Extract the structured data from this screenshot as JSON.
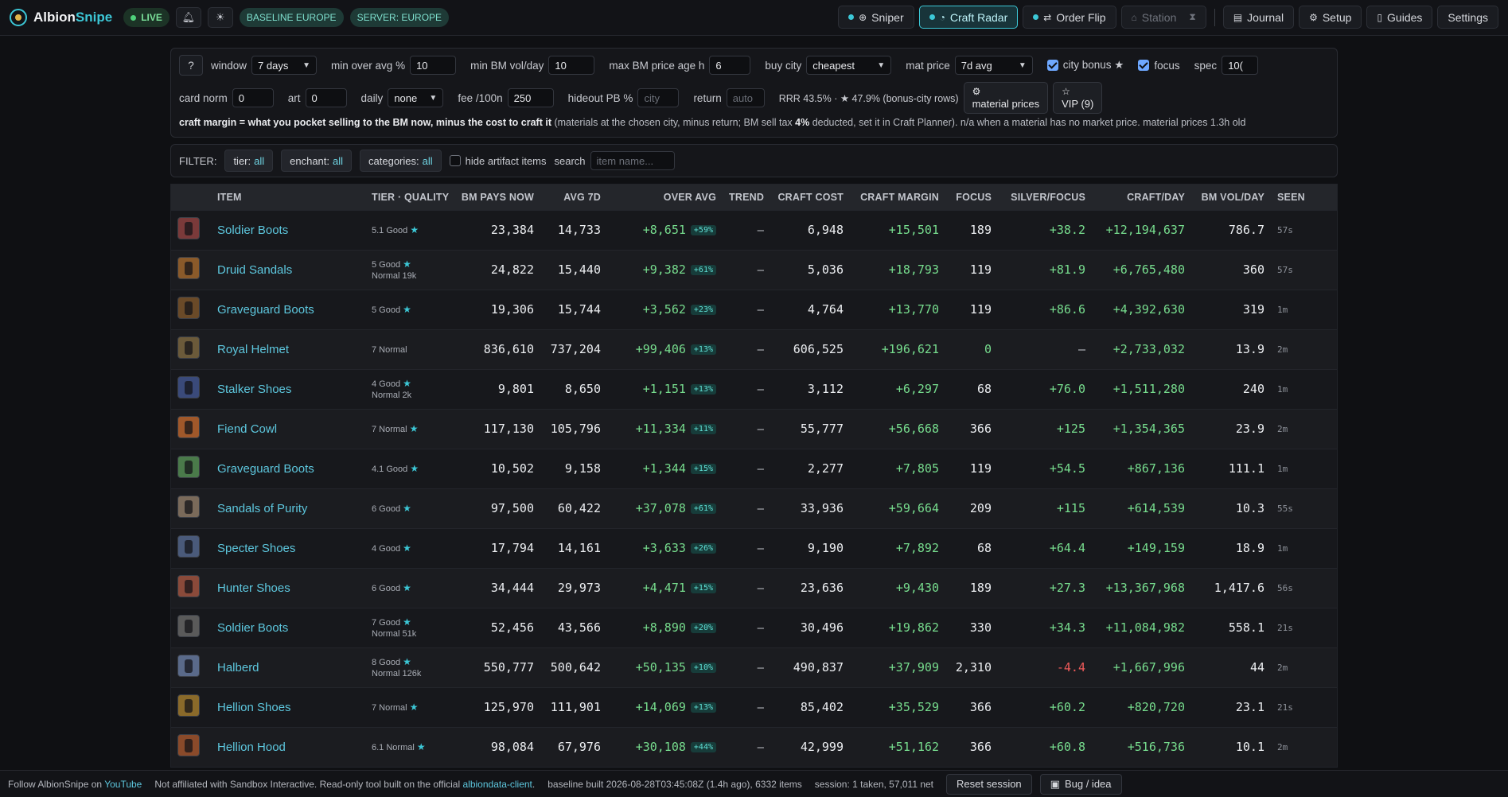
{
  "header": {
    "brand_a": "Albion",
    "brand_b": "Snipe",
    "live": "LIVE",
    "baseline": "BASELINE EUROPE",
    "server": "SERVER: EUROPE",
    "nav": [
      {
        "label": "Sniper",
        "icon": "target-icon"
      },
      {
        "label": "Craft Radar",
        "icon": "radar-icon"
      },
      {
        "label": "Order Flip",
        "icon": "swap-icon"
      },
      {
        "label": "Station",
        "icon": "house-icon"
      },
      {
        "label": "Journal",
        "icon": "journal-icon"
      },
      {
        "label": "Setup",
        "icon": "gear-icon"
      },
      {
        "label": "Guides",
        "icon": "book-icon"
      },
      {
        "label": "Settings"
      }
    ]
  },
  "controls": {
    "help": "?",
    "window_label": "window",
    "window_value": "7 days",
    "min_over_avg_label": "min over avg %",
    "min_over_avg_value": "10",
    "min_bm_vol_label": "min BM vol/day",
    "min_bm_vol_value": "10",
    "max_bm_age_label": "max BM price age h",
    "max_bm_age_value": "6",
    "buy_city_label": "buy city",
    "buy_city_value": "cheapest",
    "mat_price_label": "mat price",
    "mat_price_value": "7d avg",
    "city_bonus_label": "city bonus ★",
    "focus_label": "focus",
    "spec_label": "spec",
    "spec_value": "10(",
    "card_norm_label": "card norm",
    "card_norm_value": "0",
    "art_label": "art",
    "art_value": "0",
    "daily_label": "daily",
    "daily_value": "none",
    "fee_label": "fee /100n",
    "fee_value": "250",
    "hideout_label": "hideout PB %",
    "hideout_placeholder": "city",
    "return_label": "return",
    "return_placeholder": "auto",
    "rrr_text": "RRR 43.5% · ★ 47.9% (bonus-city rows)",
    "material_prices_label": "material prices",
    "vip_label": "VIP (9)",
    "desc_bold": "craft margin = what you pocket selling to the BM now, minus the cost to craft it",
    "desc_rest_a": " (materials at the chosen city, minus return; BM sell tax ",
    "desc_tax": "4%",
    "desc_rest_b": " deducted, set it in Craft Planner). n/a when a material has no market price. material prices 1.3h old"
  },
  "filters": {
    "label": "FILTER:",
    "tier_label": "tier:",
    "tier_value": "all",
    "enchant_label": "enchant:",
    "enchant_value": "all",
    "categories_label": "categories:",
    "categories_value": "all",
    "hide_artifact": "hide artifact items",
    "search_label": "search",
    "search_placeholder": "item name..."
  },
  "table": {
    "columns": [
      "ITEM",
      "TIER · QUALITY",
      "BM PAYS NOW",
      "AVG 7D",
      "OVER AVG",
      "TREND",
      "CRAFT COST",
      "CRAFT MARGIN",
      "FOCUS",
      "SILVER/FOCUS",
      "CRAFT/DAY",
      "BM VOL/DAY",
      "SEEN"
    ],
    "rows": [
      {
        "icon": "#7a3a3a",
        "name": "Soldier Boots",
        "tier": "5.1 Good",
        "star": "★",
        "sub": "",
        "bm": "23,384",
        "avg": "14,733",
        "over": "+8,651",
        "pct": "+59%",
        "trend": "–",
        "cost": "6,948",
        "margin": "+15,501",
        "focus": "189",
        "spf": "+38.2",
        "cpd": "+12,194,637",
        "vol": "786.7",
        "seen": "57s"
      },
      {
        "icon": "#8a5a2a",
        "name": "Druid Sandals",
        "tier": "5 Good",
        "star": "★",
        "sub": "Normal 19k",
        "bm": "24,822",
        "avg": "15,440",
        "over": "+9,382",
        "pct": "+61%",
        "trend": "–",
        "cost": "5,036",
        "margin": "+18,793",
        "focus": "119",
        "spf": "+81.9",
        "cpd": "+6,765,480",
        "vol": "360",
        "seen": "57s"
      },
      {
        "icon": "#6a4a28",
        "name": "Graveguard Boots",
        "tier": "5 Good",
        "star": "★",
        "sub": "",
        "bm": "19,306",
        "avg": "15,744",
        "over": "+3,562",
        "pct": "+23%",
        "trend": "–",
        "cost": "4,764",
        "margin": "+13,770",
        "focus": "119",
        "spf": "+86.6",
        "cpd": "+4,392,630",
        "vol": "319",
        "seen": "1m"
      },
      {
        "icon": "#6b5a3a",
        "name": "Royal Helmet",
        "tier": "7 Normal",
        "star": "",
        "sub": "",
        "bm": "836,610",
        "avg": "737,204",
        "over": "+99,406",
        "pct": "+13%",
        "trend": "–",
        "cost": "606,525",
        "margin": "+196,621",
        "focus": "0",
        "spf": "–",
        "cpd": "+2,733,032",
        "vol": "13.9",
        "seen": "2m"
      },
      {
        "icon": "#3a4a7a",
        "name": "Stalker Shoes",
        "tier": "4 Good",
        "star": "★",
        "sub": "Normal 2k",
        "bm": "9,801",
        "avg": "8,650",
        "over": "+1,151",
        "pct": "+13%",
        "trend": "–",
        "cost": "3,112",
        "margin": "+6,297",
        "focus": "68",
        "spf": "+76.0",
        "cpd": "+1,511,280",
        "vol": "240",
        "seen": "1m"
      },
      {
        "icon": "#a0582a",
        "name": "Fiend Cowl",
        "tier": "7 Normal",
        "star": "★",
        "sub": "",
        "bm": "117,130",
        "avg": "105,796",
        "over": "+11,334",
        "pct": "+11%",
        "trend": "–",
        "cost": "55,777",
        "margin": "+56,668",
        "focus": "366",
        "spf": "+125",
        "cpd": "+1,354,365",
        "vol": "23.9",
        "seen": "2m"
      },
      {
        "icon": "#4a7a4a",
        "name": "Graveguard Boots",
        "tier": "4.1 Good",
        "star": "★",
        "sub": "",
        "bm": "10,502",
        "avg": "9,158",
        "over": "+1,344",
        "pct": "+15%",
        "trend": "–",
        "cost": "2,277",
        "margin": "+7,805",
        "focus": "119",
        "spf": "+54.5",
        "cpd": "+867,136",
        "vol": "111.1",
        "seen": "1m"
      },
      {
        "icon": "#7a6a5a",
        "name": "Sandals of Purity",
        "tier": "6 Good",
        "star": "★",
        "sub": "",
        "bm": "97,500",
        "avg": "60,422",
        "over": "+37,078",
        "pct": "+61%",
        "trend": "–",
        "cost": "33,936",
        "margin": "+59,664",
        "focus": "209",
        "spf": "+115",
        "cpd": "+614,539",
        "vol": "10.3",
        "seen": "55s"
      },
      {
        "icon": "#4a5a7a",
        "name": "Specter Shoes",
        "tier": "4 Good",
        "star": "★",
        "sub": "",
        "bm": "17,794",
        "avg": "14,161",
        "over": "+3,633",
        "pct": "+26%",
        "trend": "–",
        "cost": "9,190",
        "margin": "+7,892",
        "focus": "68",
        "spf": "+64.4",
        "cpd": "+149,159",
        "vol": "18.9",
        "seen": "1m"
      },
      {
        "icon": "#8a4a3a",
        "name": "Hunter Shoes",
        "tier": "6 Good",
        "star": "★",
        "sub": "",
        "bm": "34,444",
        "avg": "29,973",
        "over": "+4,471",
        "pct": "+15%",
        "trend": "–",
        "cost": "23,636",
        "margin": "+9,430",
        "focus": "189",
        "spf": "+27.3",
        "cpd": "+13,367,968",
        "vol": "1,417.6",
        "seen": "56s"
      },
      {
        "icon": "#5a5a5a",
        "name": "Soldier Boots",
        "tier": "7 Good",
        "star": "★",
        "sub": "Normal 51k",
        "bm": "52,456",
        "avg": "43,566",
        "over": "+8,890",
        "pct": "+20%",
        "trend": "–",
        "cost": "30,496",
        "margin": "+19,862",
        "focus": "330",
        "spf": "+34.3",
        "cpd": "+11,084,982",
        "vol": "558.1",
        "seen": "21s"
      },
      {
        "icon": "#5a6a8a",
        "name": "Halberd",
        "tier": "8 Good",
        "star": "★",
        "sub": "Normal 126k",
        "bm": "550,777",
        "avg": "500,642",
        "over": "+50,135",
        "pct": "+10%",
        "trend": "–",
        "cost": "490,837",
        "margin": "+37,909",
        "focus": "2,310",
        "spf": "-4.4",
        "cpd": "+1,667,996",
        "vol": "44",
        "seen": "2m"
      },
      {
        "icon": "#8a6a2a",
        "name": "Hellion Shoes",
        "tier": "7 Normal",
        "star": "★",
        "sub": "",
        "bm": "125,970",
        "avg": "111,901",
        "over": "+14,069",
        "pct": "+13%",
        "trend": "–",
        "cost": "85,402",
        "margin": "+35,529",
        "focus": "366",
        "spf": "+60.2",
        "cpd": "+820,720",
        "vol": "23.1",
        "seen": "21s"
      },
      {
        "icon": "#8a4a2a",
        "name": "Hellion Hood",
        "tier": "6.1 Normal",
        "star": "★",
        "sub": "",
        "bm": "98,084",
        "avg": "67,976",
        "over": "+30,108",
        "pct": "+44%",
        "trend": "–",
        "cost": "42,999",
        "margin": "+51,162",
        "focus": "366",
        "spf": "+60.8",
        "cpd": "+516,736",
        "vol": "10.1",
        "seen": "2m"
      }
    ]
  },
  "footer": {
    "follow": "Follow AlbionSnipe on",
    "youtube": "YouTube",
    "affiliation": "Not affiliated with Sandbox Interactive. Read-only tool built on the official",
    "client": "albiondata-client",
    "baseline": "baseline built 2026-08-28T03:45:08Z (1.4h ago), 6332 items",
    "session": "session: 1 taken, 57,011 net",
    "reset": "Reset session",
    "bug": "Bug / idea"
  }
}
